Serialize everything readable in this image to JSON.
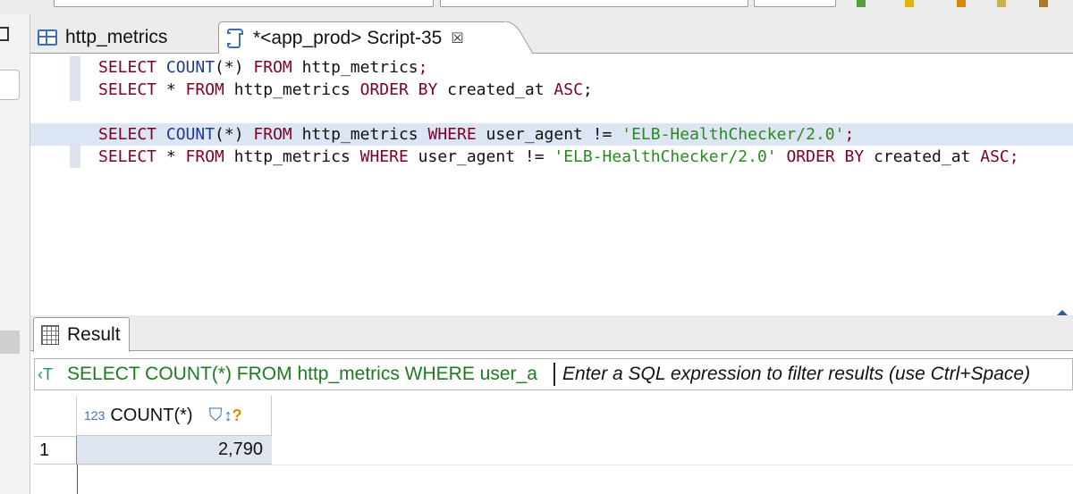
{
  "tabs": [
    {
      "label": "http_metrics",
      "icon": "table-icon",
      "active": false
    },
    {
      "label": "*<app_prod> Script-35",
      "icon": "script-icon",
      "active": true
    }
  ],
  "editor": {
    "lines": [
      {
        "tokens": [
          {
            "t": "SELECT ",
            "c": "kw"
          },
          {
            "t": "COUNT",
            "c": "fn"
          },
          {
            "t": "(*) ",
            "c": "pl"
          },
          {
            "t": "FROM ",
            "c": "kw"
          },
          {
            "t": "http_metrics",
            "c": "pl"
          },
          {
            "t": ";",
            "c": "kw"
          }
        ]
      },
      {
        "tokens": [
          {
            "t": "SELECT ",
            "c": "kw"
          },
          {
            "t": "* ",
            "c": "pl"
          },
          {
            "t": "FROM ",
            "c": "kw"
          },
          {
            "t": "http_metrics ",
            "c": "pl"
          },
          {
            "t": "ORDER BY ",
            "c": "kw"
          },
          {
            "t": "created_at ",
            "c": "pl"
          },
          {
            "t": "ASC",
            "c": "kw"
          },
          {
            "t": ";",
            "c": "pl"
          }
        ]
      },
      {
        "tokens": []
      },
      {
        "highlight": true,
        "tokens": [
          {
            "t": "SELECT ",
            "c": "kw"
          },
          {
            "t": "COUNT",
            "c": "fn"
          },
          {
            "t": "(*) ",
            "c": "pl"
          },
          {
            "t": "FROM ",
            "c": "kw"
          },
          {
            "t": "http_metrics ",
            "c": "pl"
          },
          {
            "t": "WHERE ",
            "c": "kw"
          },
          {
            "t": "user_agent != ",
            "c": "pl"
          },
          {
            "t": "'ELB-HealthChecker/2.0'",
            "c": "str"
          },
          {
            "t": ";",
            "c": "kw"
          }
        ]
      },
      {
        "tokens": [
          {
            "t": "SELECT ",
            "c": "kw"
          },
          {
            "t": "* ",
            "c": "pl"
          },
          {
            "t": "FROM ",
            "c": "kw"
          },
          {
            "t": "http_metrics ",
            "c": "pl"
          },
          {
            "t": "WHERE ",
            "c": "kw"
          },
          {
            "t": "user_agent != ",
            "c": "pl"
          },
          {
            "t": "'ELB-HealthChecker/2.0' ",
            "c": "str"
          },
          {
            "t": "ORDER BY ",
            "c": "kw"
          },
          {
            "t": "created_at ",
            "c": "pl"
          },
          {
            "t": "ASC",
            "c": "kw"
          },
          {
            "t": ";",
            "c": "kw"
          }
        ]
      }
    ]
  },
  "result": {
    "tab_label": "Result",
    "filter_query": "SELECT COUNT(*) FROM http_metrics WHERE user_a",
    "filter_placeholder": "Enter a SQL expression to filter results (use Ctrl+Space)",
    "column": {
      "type_badge": "123",
      "name": "COUNT(*)"
    },
    "rows": [
      {
        "num": "1",
        "value": "2,790"
      }
    ]
  },
  "colors": {
    "keyword": "#7f0024",
    "function": "#1f3b8c",
    "string": "#2a8a1f",
    "selection": "#dbe5f3"
  }
}
